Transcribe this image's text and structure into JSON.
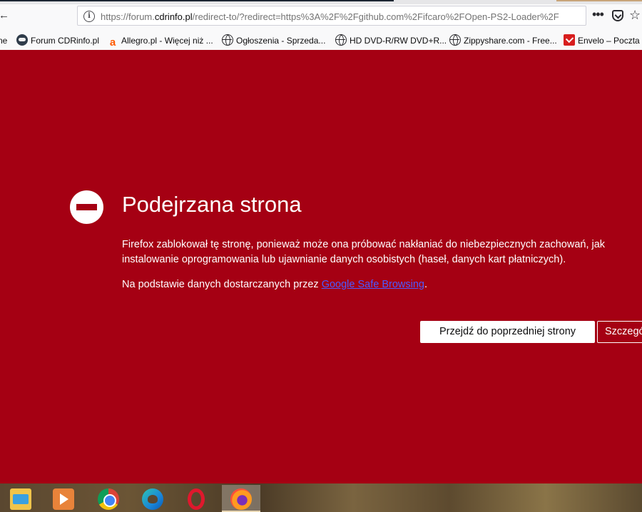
{
  "browser": {
    "url": {
      "prefix": "https://forum.",
      "host": "cdrinfo.pl",
      "path": "/redirect-to/?redirect=https%3A%2F%2Fgithub.com%2Fifcaro%2FOpen-PS2-Loader%2F"
    },
    "back_glyph": "←",
    "page_actions_glyph": "•••",
    "bookmark_star_glyph": "☆"
  },
  "bookmarks": [
    {
      "label": "ne",
      "icon": "none"
    },
    {
      "label": "Forum CDRinfo.pl",
      "icon": "cdrinfo-icon"
    },
    {
      "label": "Allegro.pl - Więcej niż ...",
      "icon": "allegro-icon"
    },
    {
      "label": "Ogłoszenia - Sprzeda...",
      "icon": "globe-icon"
    },
    {
      "label": "HD DVD-R/RW DVD+R...",
      "icon": "globe-icon"
    },
    {
      "label": "Zippyshare.com - Free...",
      "icon": "globe-icon"
    },
    {
      "label": "Envelo – Poczta Po",
      "icon": "envelo-icon"
    }
  ],
  "allegro_glyph": "a",
  "warning": {
    "title": "Podejrzana strona",
    "paragraph1": "Firefox zablokował tę stronę, ponieważ może ona próbować nakłaniać do niebezpiecznych zachowań, jak instalowanie oprogramowania lub ujawnianie danych osobistych (haseł, danych kart płatniczych).",
    "paragraph2_prefix": "Na podstawie danych dostarczanych przez ",
    "paragraph2_link": "Google Safe Browsing",
    "paragraph2_suffix": ".",
    "back_button": "Przejdź do poprzedniej strony",
    "details_button": "Szczegóły"
  },
  "taskbar": {
    "apps": [
      "file-explorer-icon",
      "media-player-icon",
      "chrome-icon",
      "edge-icon",
      "opera-icon",
      "firefox-icon"
    ],
    "active": "firefox-icon"
  },
  "colors": {
    "warning_bg": "#a50013",
    "link": "#4d5aff"
  }
}
